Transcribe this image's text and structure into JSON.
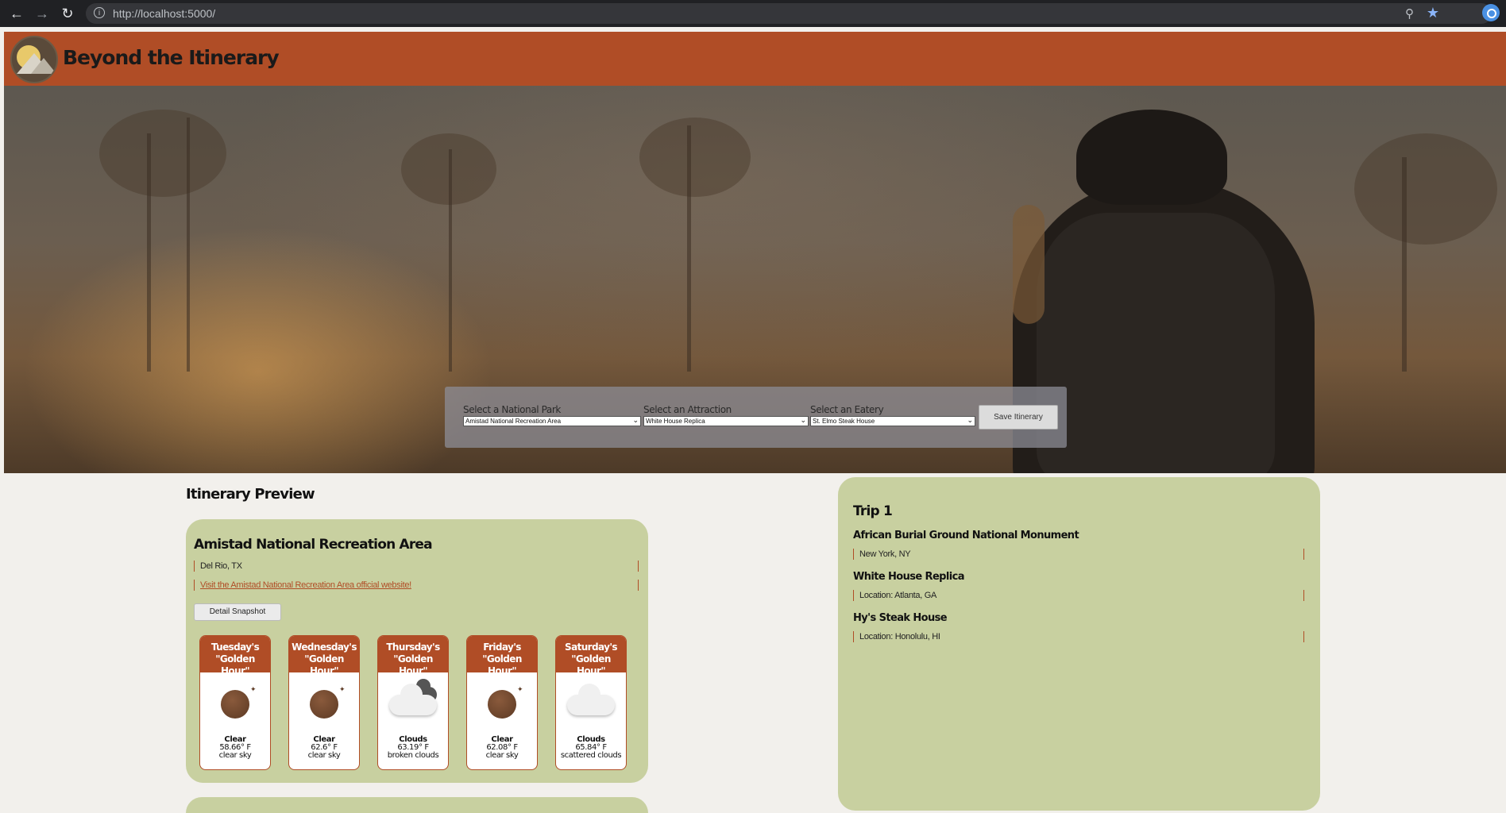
{
  "browser": {
    "url": "http://localhost:5000/",
    "back_icon": "arrow-left-icon",
    "forward_icon": "arrow-right-icon",
    "reload_icon": "reload-icon"
  },
  "site": {
    "title": "Beyond the Itinerary",
    "logo_text": "Beyond the Itinerary"
  },
  "selectors": {
    "park_label": "Select a National Park",
    "park_value": "Amistad National Recreation Area",
    "attraction_label": "Select an Attraction",
    "attraction_value": "White House Replica",
    "eatery_label": "Select an Eatery",
    "eatery_value": "St. Elmo Steak House",
    "save_label": "Save Itinerary"
  },
  "preview": {
    "heading": "Itinerary Preview",
    "park_name": "Amistad National Recreation Area",
    "location": "Del Rio, TX",
    "website_text": "Visit the Amistad National Recreation Area official website!",
    "detail_button": "Detail Snapshot",
    "forecast": [
      {
        "day": "Tuesday's",
        "label": "\"Golden Hour\"",
        "condition": "Clear",
        "temp": "58.66° F",
        "desc": "clear sky",
        "icon": "clear-night-icon"
      },
      {
        "day": "Wednesday's",
        "label": "\"Golden Hour\"",
        "condition": "Clear",
        "temp": "62.6° F",
        "desc": "clear sky",
        "icon": "clear-night-icon"
      },
      {
        "day": "Thursday's",
        "label": "\"Golden Hour\"",
        "condition": "Clouds",
        "temp": "63.19° F",
        "desc": "broken clouds",
        "icon": "broken-clouds-icon"
      },
      {
        "day": "Friday's",
        "label": "\"Golden Hour\"",
        "condition": "Clear",
        "temp": "62.08° F",
        "desc": "clear sky",
        "icon": "clear-night-icon"
      },
      {
        "day": "Saturday's",
        "label": "\"Golden Hour\"",
        "condition": "Clouds",
        "temp": "65.84° F",
        "desc": "scattered clouds",
        "icon": "scattered-clouds-icon"
      }
    ]
  },
  "trip": {
    "title": "Trip 1",
    "items": [
      {
        "name": "African Burial Ground National Monument",
        "location": "New York, NY"
      },
      {
        "name": "White House Replica",
        "location": "Location: Atlanta, GA"
      },
      {
        "name": "Hy's Steak House",
        "location": "Location: Honolulu, HI"
      }
    ]
  },
  "colors": {
    "header": "#b04d26",
    "card": "#c8d0a0",
    "page": "#f2f0ec"
  }
}
